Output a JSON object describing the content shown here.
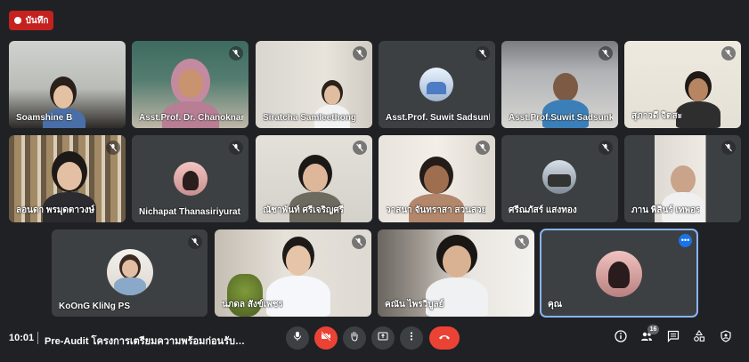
{
  "recording": {
    "label": "บันทึก"
  },
  "participants": [
    {
      "name": "Soamshine B",
      "muted": false
    },
    {
      "name": "Asst.Prof. Dr. Chanoknart Mayusoh",
      "muted": true
    },
    {
      "name": "Siratcha Samleethong",
      "muted": true
    },
    {
      "name": "Asst.Prof. Suwit Sadsunk",
      "muted": true
    },
    {
      "name": "Asst.Prof.Suwit Sadsunk",
      "muted": true
    },
    {
      "name": "สุภาวดี จิตสะ",
      "muted": true
    },
    {
      "name": "ลอนดา พรมุดตาวงษ์",
      "muted": true
    },
    {
      "name": "Nichapat Thanasiriyurat",
      "muted": true
    },
    {
      "name": "ณัชาพันท์ ศรีเจริญศรี",
      "muted": true
    },
    {
      "name": "วาสนา จันทราสา สวนสวย",
      "muted": true
    },
    {
      "name": "ศรีณภัสร์ แสงทอง",
      "muted": true
    },
    {
      "name": "ภาน พิสินร์ เทพอร",
      "muted": true
    },
    {
      "name": "KoOnG KliNg PS",
      "muted": true
    },
    {
      "name": "นภดล สังข์เพชร",
      "muted": true
    },
    {
      "name": "คณัน ไพรวิบูลย์",
      "muted": true
    },
    {
      "name": "คุณ",
      "muted": false
    }
  ],
  "bottom_bar": {
    "time": "10:01",
    "meeting_title": "Pre-Audit โครงการเตรียมความพร้อมก่อนรับการตรวจ...",
    "participant_count": "16",
    "controls": [
      "microphone-icon",
      "camera-off-icon",
      "raise-hand-icon",
      "present-icon",
      "more-options-icon",
      "hang-up-icon"
    ],
    "right_icons": [
      "info-icon",
      "people-icon",
      "chat-icon",
      "activities-icon",
      "host-controls-icon"
    ]
  },
  "colors": {
    "background": "#202124",
    "tile": "#3c4043",
    "hangup": "#ea4335",
    "record": "#c5221f",
    "active_outline": "#8ab4f8"
  }
}
